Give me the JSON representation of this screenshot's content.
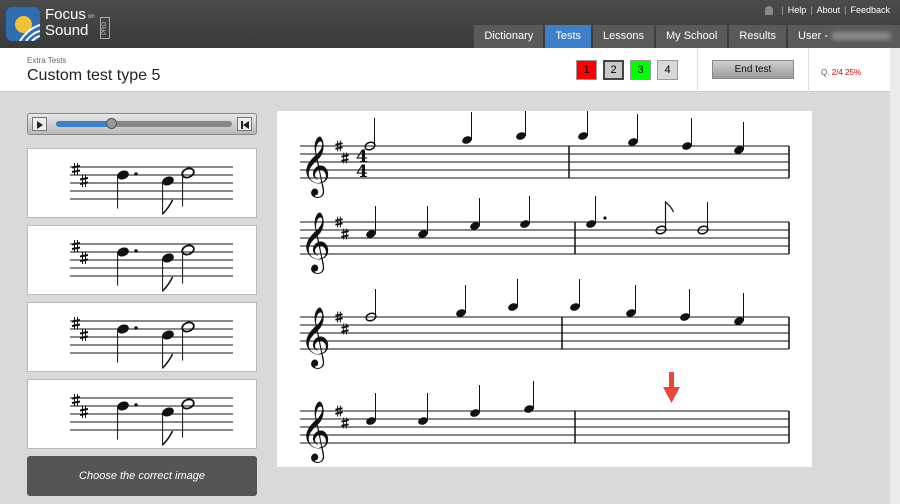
{
  "app": {
    "logo_focus": "Focus",
    "logo_sound": "Sound",
    "logo_on": "on",
    "logo_pro": "PRO"
  },
  "header": {
    "util_links": [
      "Help",
      "About",
      "Feedback"
    ],
    "tabs": [
      {
        "label": "Dictionary",
        "active": false
      },
      {
        "label": "Tests",
        "active": true
      },
      {
        "label": "Lessons",
        "active": false
      },
      {
        "label": "My School",
        "active": false
      },
      {
        "label": "Results",
        "active": false
      },
      {
        "label": "User -",
        "active": false
      }
    ]
  },
  "page": {
    "breadcrumb": "Extra Tests",
    "title": "Custom test type 5",
    "question_buttons": [
      {
        "label": "1",
        "color": "#ff0000"
      },
      {
        "label": "2",
        "color": "#c8c8c8"
      },
      {
        "label": "3",
        "color": "#00ff00"
      },
      {
        "label": "4",
        "color": "#d8d8d8"
      }
    ],
    "end_test_label": "End test",
    "progress_prefix": "Q.",
    "progress_count": "2/4",
    "progress_percent": "25%"
  },
  "player": {
    "position_fraction": 0.31
  },
  "options": {
    "count": 4,
    "choose_label": "Choose the correct image"
  },
  "score": {
    "time_signature_top": "4",
    "time_signature_bottom": "4"
  },
  "colors": {
    "accent": "#3d7fc9",
    "arrow": "#e8473c"
  },
  "icons": [
    "bell-icon",
    "play-icon",
    "rewind-icon",
    "down-arrow-icon"
  ]
}
